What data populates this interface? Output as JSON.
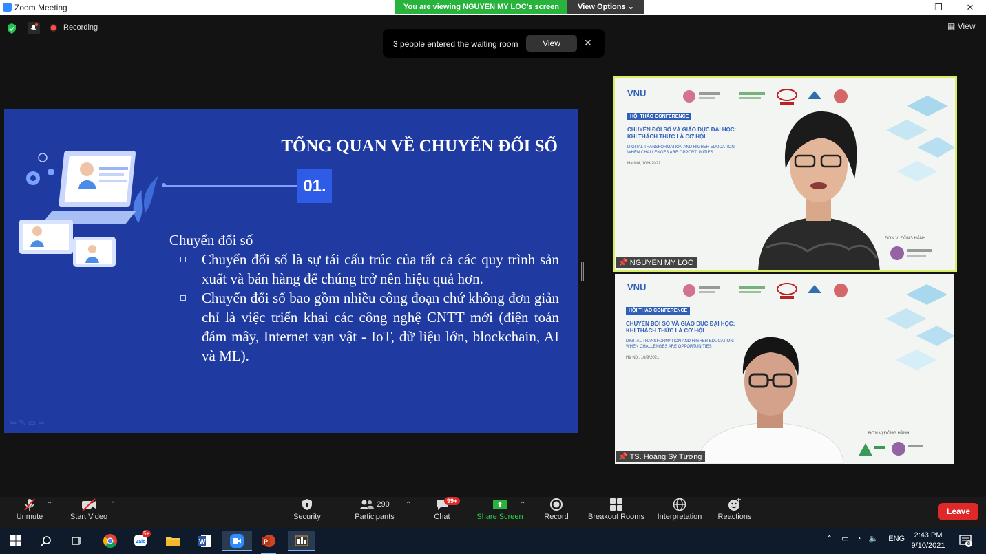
{
  "window": {
    "title": "Zoom Meeting",
    "minimize": "—",
    "maximize": "❐",
    "close": "✕"
  },
  "banner": {
    "viewing": "You are viewing NGUYEN MY LOC's screen",
    "view_options": "View Options ⌄"
  },
  "status": {
    "recording": "Recording",
    "view_label": "View"
  },
  "notification": {
    "message": "3 people entered the waiting room",
    "view_button": "View",
    "close": "✕"
  },
  "slide": {
    "title": "TỔNG QUAN VỀ CHUYỂN ĐỔI SỐ",
    "number": "01.",
    "heading": "Chuyển đổi số",
    "bullets": [
      "Chuyển đổi số là sự tái cấu trúc của tất cả các quy trình sản xuất và bán hàng để chúng trở nên hiệu quả hơn.",
      "Chuyển đổi số bao gồm nhiều công đoạn chứ không đơn giản chỉ là việc triển khai các công nghệ CNTT mới (điện toán đám mây, Internet vạn vật - IoT, dữ liệu lớn, blockchain, AI và ML)."
    ]
  },
  "participants_tiles": [
    {
      "name": "NGUYEN MY LOC",
      "badge": "HỘI THẢO CONFERENCE",
      "conf_title": "CHUYỂN ĐỔI SỐ VÀ GIÁO DỤC ĐẠI HỌC: KHI THÁCH THỨC LÀ CƠ HỘI",
      "conf_sub": "DIGITAL TRANSFORMATION AND HIGHER EDUCATION: WHEN CHALLENGES ARE OPPORTUNITIES",
      "date": "Hà Nội, 10/9/2021",
      "co_org": "ĐƠN VỊ ĐỒNG HÀNH",
      "logo": "VNU"
    },
    {
      "name": "TS. Hoàng Sỹ Tương",
      "badge": "HỘI THẢO CONFERENCE",
      "conf_title": "CHUYỂN ĐỔI SỐ VÀ GIÁO DỤC ĐẠI HỌC: KHI THÁCH THỨC LÀ CƠ HỘI",
      "conf_sub": "DIGITAL TRANSFORMATION AND HIGHER EDUCATION: WHEN CHALLENGES ARE OPPORTUNITIES",
      "date": "Hà Nội, 10/9/2021",
      "co_org": "ĐƠN VỊ ĐỒNG HÀNH",
      "logo": "VNU"
    }
  ],
  "toolbar": {
    "unmute": "Unmute",
    "start_video": "Start Video",
    "security": "Security",
    "participants": "Participants",
    "participants_count": "290",
    "chat": "Chat",
    "chat_badge": "99+",
    "share_screen": "Share Screen",
    "record": "Record",
    "breakout_rooms": "Breakout Rooms",
    "interpretation": "Interpretation",
    "reactions": "Reactions",
    "leave": "Leave"
  },
  "taskbar": {
    "language": "ENG",
    "time": "2:43 PM",
    "date": "9/10/2021",
    "notifications": "8",
    "zalo_badge": "5+"
  },
  "colors": {
    "slide_bg": "#1f3aa0",
    "banner_green": "#28b43c",
    "leave_red": "#e02828",
    "active_speaker": "#d7ef62",
    "share_green": "#28b43c"
  }
}
